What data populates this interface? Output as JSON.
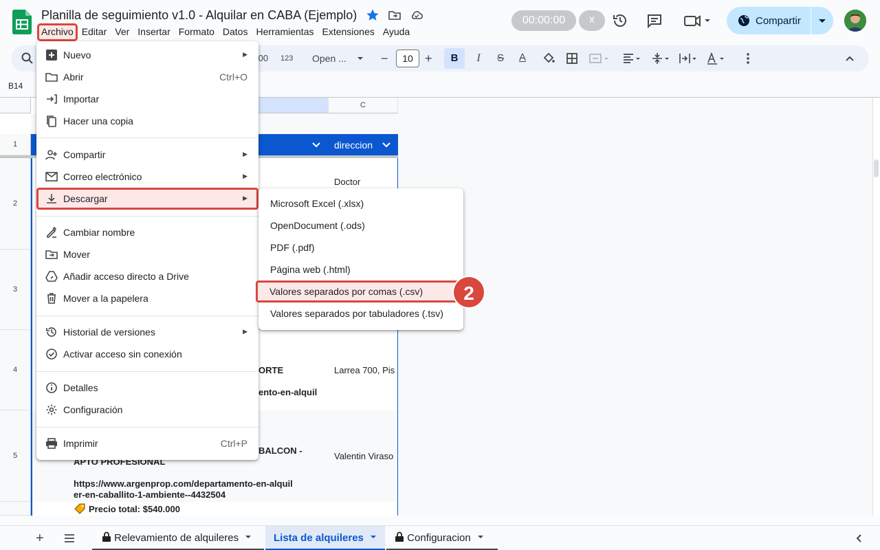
{
  "header": {
    "doc_title": "Planilla de seguimiento v1.0 - Alquilar en CABA (Ejemplo)",
    "timer": "00:00:00",
    "timer_close": "x",
    "share_label": "Compartir"
  },
  "menubar": [
    "Archivo",
    "Editar",
    "Ver",
    "Insertar",
    "Formato",
    "Datos",
    "Herramientas",
    "Extensiones",
    "Ayuda"
  ],
  "toolbar": {
    "decimals": ".00",
    "number_format": "123",
    "font": "Open ...",
    "font_size": "10",
    "minus": "−",
    "plus": "+"
  },
  "name_box": "B14",
  "grid": {
    "col_c_header": "C",
    "rows": [
      "1",
      "2",
      "3",
      "4",
      "5"
    ],
    "header_cell": "direccion",
    "cells": {
      "c2": "Doctor",
      "b4a": "ORTE",
      "b4b": "ento-en-alquil",
      "c4": "Larrea 700, Pis",
      "b5a": "BALCON -",
      "b5b": "APTO PROFESIONAL",
      "b5c": "https://www.argenprop.com/departamento-en-alquil",
      "b5d": "er-en-caballito-1-ambiente--4432504",
      "b5e": "Precio total: $540.000",
      "c5": "Valentin Viraso"
    }
  },
  "file_menu": {
    "items": [
      {
        "label": "Nuevo",
        "icon": "plus-box-icon",
        "submenu": true
      },
      {
        "label": "Abrir",
        "icon": "folder-icon",
        "shortcut": "Ctrl+O"
      },
      {
        "label": "Importar",
        "icon": "import-icon"
      },
      {
        "label": "Hacer una copia",
        "icon": "copy-icon"
      },
      {
        "label": "Compartir",
        "icon": "person-add-icon",
        "submenu": true
      },
      {
        "label": "Correo electrónico",
        "icon": "mail-icon",
        "submenu": true
      },
      {
        "label": "Descargar",
        "icon": "download-icon",
        "submenu": true
      },
      {
        "label": "Cambiar nombre",
        "icon": "rename-icon"
      },
      {
        "label": "Mover",
        "icon": "move-folder-icon"
      },
      {
        "label": "Añadir acceso directo a Drive",
        "icon": "drive-shortcut-icon"
      },
      {
        "label": "Mover a la papelera",
        "icon": "trash-icon"
      },
      {
        "label": "Historial de versiones",
        "icon": "history-icon",
        "submenu": true
      },
      {
        "label": "Activar acceso sin conexión",
        "icon": "offline-icon"
      },
      {
        "label": "Detalles",
        "icon": "info-icon"
      },
      {
        "label": "Configuración",
        "icon": "gear-icon"
      },
      {
        "label": "Imprimir",
        "icon": "print-icon",
        "shortcut": "Ctrl+P"
      }
    ]
  },
  "download_menu": {
    "items": [
      "Microsoft Excel (.xlsx)",
      "OpenDocument (.ods)",
      "PDF (.pdf)",
      "Página web (.html)",
      "Valores separados por comas (.csv)",
      "Valores separados por tabuladores (.tsv)"
    ]
  },
  "step_badge": "2",
  "sheet_tabs": [
    "Relevamiento de alquileres",
    "Lista de alquileres",
    "Configuracion"
  ],
  "colors": {
    "highlight_red": "#d9473d",
    "header_blue": "#0b57d0",
    "share_bg": "#c2e7ff"
  }
}
